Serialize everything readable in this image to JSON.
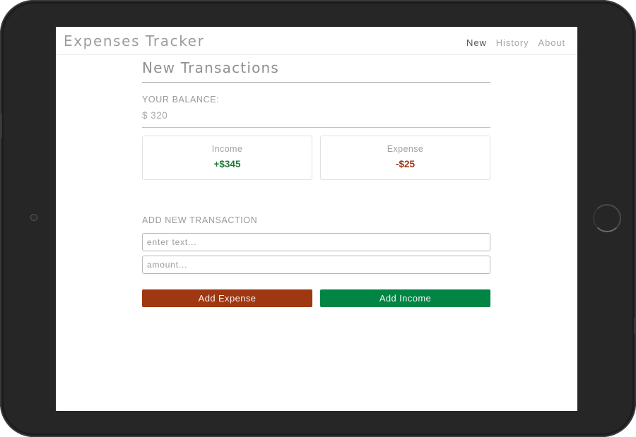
{
  "app": {
    "title": "Expenses Tracker"
  },
  "nav": {
    "items": [
      {
        "label": "New",
        "active": true
      },
      {
        "label": "History",
        "active": false
      },
      {
        "label": "About",
        "active": false
      }
    ]
  },
  "page": {
    "title": "New Transactions"
  },
  "balance": {
    "label": "YOUR BALANCE:",
    "value": "$ 320"
  },
  "summary": {
    "income": {
      "label": "Income",
      "amount": "+$345",
      "color": "#1f7a3a"
    },
    "expense": {
      "label": "Expense",
      "amount": "-$25",
      "color": "#9b3315"
    }
  },
  "form": {
    "heading": "ADD NEW TRANSACTION",
    "text_input": {
      "value": "",
      "placeholder": "enter text..."
    },
    "amount_input": {
      "value": "",
      "placeholder": "amount..."
    },
    "add_expense_label": "Add Expense",
    "add_income_label": "Add Income",
    "expense_color": "#9f3710",
    "income_color": "#008544"
  },
  "device": {
    "icons": [
      "camera-icon",
      "home-button-icon"
    ]
  }
}
